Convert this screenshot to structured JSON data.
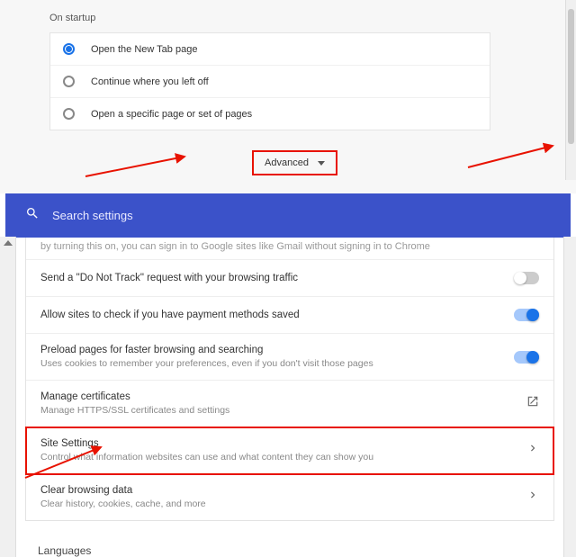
{
  "startup": {
    "title": "On startup",
    "radios": [
      {
        "label": "Open the New Tab page",
        "checked": true
      },
      {
        "label": "Continue where you left off",
        "checked": false
      },
      {
        "label": "Open a specific page or set of pages",
        "checked": false
      }
    ]
  },
  "advanced_label": "Advanced",
  "search": {
    "placeholder": "Search settings"
  },
  "cutoff_text": "by turning this on, you can sign in to Google sites like Gmail without signing in to Chrome",
  "rows": {
    "dnt": {
      "primary": "Send a \"Do Not Track\" request with your browsing traffic",
      "sub": "",
      "toggle_on": false
    },
    "payment": {
      "primary": "Allow sites to check if you have payment methods saved",
      "sub": "",
      "toggle_on": true
    },
    "preload": {
      "primary": "Preload pages for faster browsing and searching",
      "sub": "Uses cookies to remember your preferences, even if you don't visit those pages",
      "toggle_on": true
    },
    "certs": {
      "primary": "Manage certificates",
      "sub": "Manage HTTPS/SSL certificates and settings"
    },
    "site": {
      "primary": "Site Settings",
      "sub": "Control what information websites can use and what content they can show you"
    },
    "clear": {
      "primary": "Clear browsing data",
      "sub": "Clear history, cookies, cache, and more"
    }
  },
  "languages_label": "Languages",
  "annotation_color": "#e81200"
}
